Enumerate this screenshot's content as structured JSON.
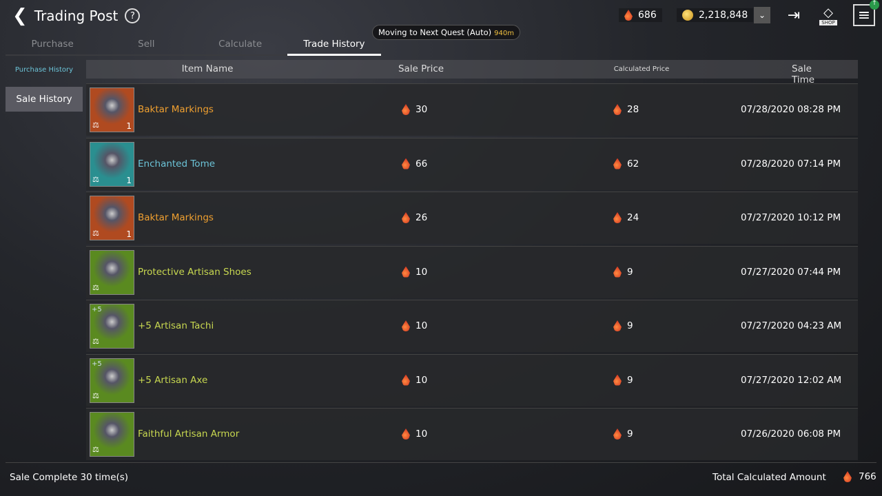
{
  "header": {
    "title": "Trading Post",
    "gems": "686",
    "gold": "2,218,848",
    "shop_label": "SHOP"
  },
  "quest": {
    "text": "Moving to Next Quest (Auto)",
    "distance": "940m"
  },
  "tabs": [
    {
      "label": "Purchase"
    },
    {
      "label": "Sell"
    },
    {
      "label": "Calculate"
    },
    {
      "label": "Trade History",
      "active": true
    }
  ],
  "sidebar": {
    "purchase_history": "Purchase History",
    "sale_history": "Sale History"
  },
  "table": {
    "headers": [
      "Item Name",
      "Sale Price",
      "Calculated Price",
      "Sale Time"
    ],
    "rows": [
      {
        "name": "Baktar Markings",
        "color": "#f0a030",
        "enh": "",
        "count": "1",
        "price": "30",
        "calc": "28",
        "time": "07/28/2020 08:28 PM",
        "bg": "#b04a20"
      },
      {
        "name": "Enchanted Tome",
        "color": "#6cc4d8",
        "enh": "",
        "count": "1",
        "price": "66",
        "calc": "62",
        "time": "07/28/2020 07:14 PM",
        "bg": "#2a8f90"
      },
      {
        "name": "Baktar Markings",
        "color": "#f0a030",
        "enh": "",
        "count": "1",
        "price": "26",
        "calc": "24",
        "time": "07/27/2020 10:12 PM",
        "bg": "#b04a20"
      },
      {
        "name": "Protective Artisan Shoes",
        "color": "#c8d850",
        "enh": "",
        "count": "",
        "price": "10",
        "calc": "9",
        "time": "07/27/2020 07:44 PM",
        "bg": "#5a8a20"
      },
      {
        "name": "+5 Artisan Tachi",
        "color": "#c8d850",
        "enh": "+5",
        "count": "",
        "price": "10",
        "calc": "9",
        "time": "07/27/2020 04:23 AM",
        "bg": "#5a8a20"
      },
      {
        "name": "+5 Artisan Axe",
        "color": "#c8d850",
        "enh": "+5",
        "count": "",
        "price": "10",
        "calc": "9",
        "time": "07/27/2020 12:02 AM",
        "bg": "#5a8a20"
      },
      {
        "name": "Faithful Artisan Armor",
        "color": "#c8d850",
        "enh": "",
        "count": "",
        "price": "10",
        "calc": "9",
        "time": "07/26/2020 06:08 PM",
        "bg": "#5a8a20"
      }
    ]
  },
  "footer": {
    "sale_complete": "Sale Complete 30 time(s)",
    "total_label": "Total Calculated Amount",
    "total": "766"
  }
}
